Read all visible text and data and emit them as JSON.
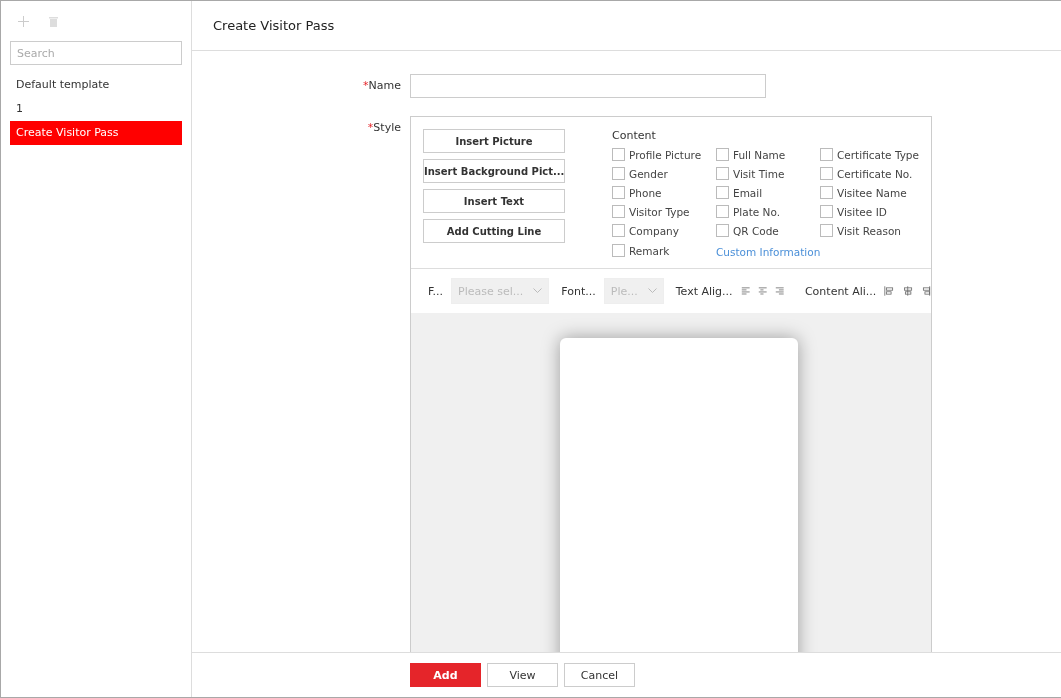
{
  "sidebar": {
    "search": {
      "placeholder": "Search"
    },
    "items": [
      {
        "label": "Default template",
        "selected": false
      },
      {
        "label": "1",
        "selected": false
      },
      {
        "label": "Create Visitor Pass",
        "selected": true
      }
    ]
  },
  "header": {
    "title": "Create Visitor Pass"
  },
  "form": {
    "name": {
      "required_mark": "*",
      "label": "Name"
    },
    "style": {
      "required_mark": "*",
      "label": "Style",
      "buttons": [
        "Insert Picture",
        "Insert Background Pict...",
        "Insert Text",
        "Add Cutting Line"
      ],
      "content_title": "Content",
      "fields": [
        {
          "label": "Profile Picture",
          "checked": false
        },
        {
          "label": "Full Name",
          "checked": false
        },
        {
          "label": "Certificate Type",
          "checked": false
        },
        {
          "label": "Gender",
          "checked": false
        },
        {
          "label": "Visit Time",
          "checked": false
        },
        {
          "label": "Certificate No.",
          "checked": false
        },
        {
          "label": "Phone",
          "checked": false
        },
        {
          "label": "Email",
          "checked": false
        },
        {
          "label": "Visitee Name",
          "checked": false
        },
        {
          "label": "Visitor Type",
          "checked": false
        },
        {
          "label": "Plate No.",
          "checked": false
        },
        {
          "label": "Visitee ID",
          "checked": false
        },
        {
          "label": "Company",
          "checked": false
        },
        {
          "label": "QR Code",
          "checked": false
        },
        {
          "label": "Visit Reason",
          "checked": false
        },
        {
          "label": "Remark",
          "checked": false
        }
      ],
      "custom_link": "Custom Information",
      "toolbar": {
        "font_label": "F...",
        "font_select": {
          "placeholder": "Please sel...",
          "disabled": true
        },
        "size_label": "Font...",
        "size_select": {
          "placeholder": "Ple...",
          "disabled": true
        },
        "text_align_label": "Text Alig...",
        "content_align_label": "Content Ali..."
      }
    }
  },
  "footer": {
    "buttons": [
      {
        "label": "Add",
        "kind": "primary"
      },
      {
        "label": "View",
        "kind": "default"
      },
      {
        "label": "Cancel",
        "kind": "default"
      }
    ]
  }
}
